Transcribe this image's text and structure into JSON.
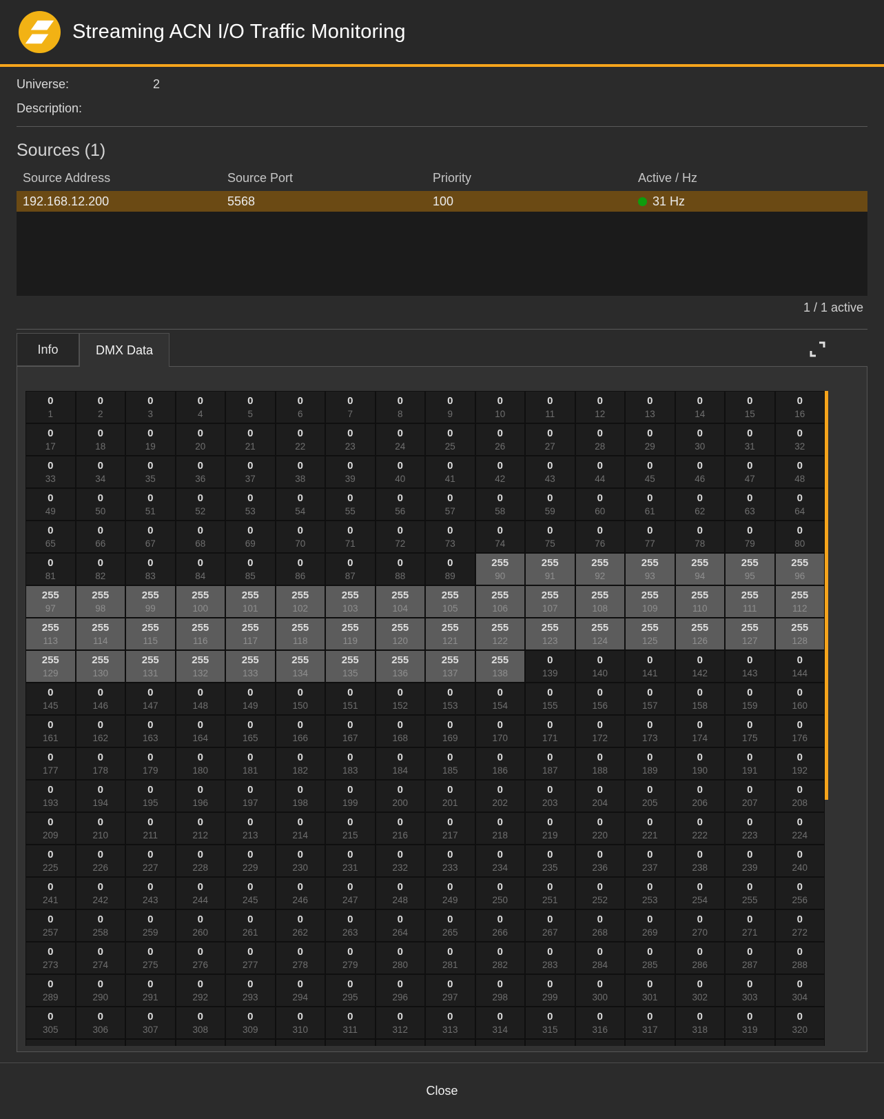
{
  "header": {
    "title": "Streaming ACN I/O Traffic Monitoring"
  },
  "meta": {
    "universe_label": "Universe:",
    "universe_value": "2",
    "description_label": "Description:",
    "description_value": ""
  },
  "sources": {
    "heading": "Sources (1)",
    "columns": [
      "Source Address",
      "Source Port",
      "Priority",
      "Active / Hz"
    ],
    "rows": [
      {
        "address": "192.168.12.200",
        "port": "5568",
        "priority": "100",
        "rate": "31 Hz",
        "active": true
      }
    ],
    "summary": "1 / 1 active"
  },
  "tabs": [
    {
      "id": "info",
      "label": "Info",
      "active": false
    },
    {
      "id": "dmx-data",
      "label": "DMX Data",
      "active": true
    }
  ],
  "dmx_grid": {
    "channels_per_row": 16,
    "first_channel": 1,
    "last_visible_channel": 320,
    "next_row_partially_visible": true,
    "values": [
      {
        "from": 1,
        "to": 89,
        "value": 0
      },
      {
        "from": 90,
        "to": 138,
        "value": 255
      },
      {
        "from": 139,
        "to": 320,
        "value": 0
      }
    ]
  },
  "footer": {
    "close_label": "Close"
  },
  "colors": {
    "accent_orange": "#F5A41C",
    "logo_yellow": "#F2B214",
    "source_row_highlight": "#6B4A14",
    "active_dot_green": "#0E9C0E",
    "cell_low_bg": "#1D1D1D",
    "cell_high_bg": "#5C5C5C"
  }
}
